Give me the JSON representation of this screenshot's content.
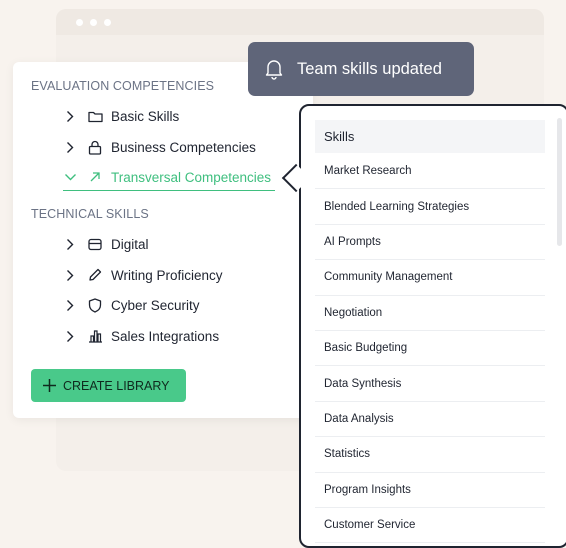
{
  "toast": {
    "message": "Team skills updated",
    "icon": "bell-icon"
  },
  "left_panel": {
    "sections": [
      {
        "title": "EVALUATION COMPETENCIES",
        "items": [
          {
            "label": "Basic Skills",
            "icon": "folder-icon"
          },
          {
            "label": "Business Competencies",
            "icon": "lock-icon"
          },
          {
            "label": "Transversal Competencies",
            "icon": "arrow-up-right-icon",
            "active": true
          }
        ]
      },
      {
        "title": "TECHNICAL SKILLS",
        "items": [
          {
            "label": "Digital",
            "icon": "card-icon"
          },
          {
            "label": "Writing Proficiency",
            "icon": "pencil-icon"
          },
          {
            "label": "Cyber Security",
            "icon": "shield-icon"
          },
          {
            "label": "Sales Integrations",
            "icon": "bar-chart-icon"
          }
        ]
      }
    ],
    "create_button": "CREATE LIBRARY"
  },
  "skills_dropdown": {
    "header": "Skills",
    "items": [
      "Market Research",
      "Blended Learning Strategies",
      "AI Prompts",
      "Community Management",
      "Negotiation",
      "Basic Budgeting",
      "Data Synthesis",
      "Data Analysis",
      "Statistics",
      "Program Insights",
      "Customer Service"
    ]
  },
  "colors": {
    "accent": "#49c98a",
    "active_text": "#3fbf7f",
    "toast_bg": "#5f6579",
    "page_bg": "#f8f3ee"
  }
}
